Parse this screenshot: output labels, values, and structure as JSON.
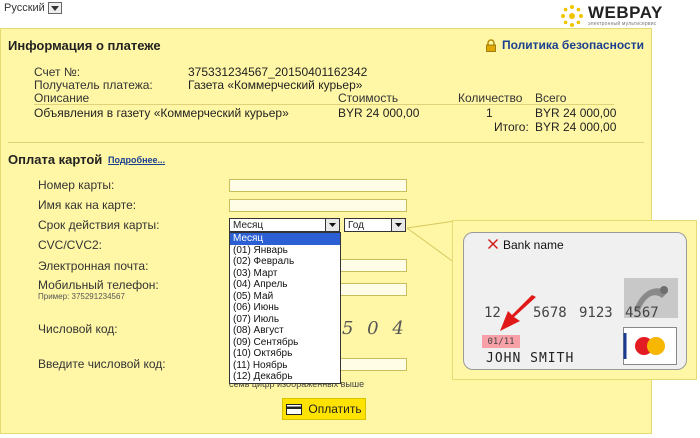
{
  "language": {
    "selected": "Русский"
  },
  "logo": {
    "brand": "WEBPAY",
    "tagline": "электронный мультисервис"
  },
  "payment_info": {
    "title": "Информация о платеже",
    "privacy_link": "Политика безопасности",
    "invoice_label": "Счет №:",
    "invoice_value": "375331234567_20150401162342",
    "recipient_label": "Получатель платежа:",
    "recipient_value": "Газета «Коммерческий курьер»",
    "table": {
      "headers": [
        "Описание",
        "Стоимость",
        "Количество",
        "Всего"
      ],
      "row": [
        "Объявления в газету «Коммерческий курьер»",
        "BYR 24 000,00",
        "1",
        "BYR 24 000,00"
      ],
      "total_label": "Итого:",
      "total_value": "BYR 24 000,00"
    }
  },
  "card_payment": {
    "title": "Оплата картой",
    "more_link": "Подробнее...",
    "card_number_label": "Номер карты:",
    "card_name_label": "Имя как на карте:",
    "expiry_label": "Срок действия карты:",
    "month_select": "Месяц",
    "year_select": "Год",
    "cvc_label": "CVC/CVC2:",
    "email_label": "Электронная почта:",
    "phone_label": "Мобильный телефон:",
    "phone_example": "Пример: 375291234567",
    "captcha_label": "Числовой код:",
    "captcha_input_label": "Введите числовой код:",
    "captcha_hint": "семь цифр изображенных выше",
    "captcha_fragment": "5 0 4",
    "pay_button": "Оплатить",
    "months": [
      "Месяц",
      "(01) Январь",
      "(02) Февраль",
      "(03) Март",
      "(04) Апрель",
      "(05) Май",
      "(06) Июнь",
      "(07) Июль",
      "(08) Август",
      "(09) Сентябрь",
      "(10) Октябрь",
      "(11) Ноябрь",
      "(12) Декабрь"
    ]
  },
  "card_illustration": {
    "bank_name": "Bank name",
    "number_start": "12",
    "number_groups": [
      "5678",
      "9123",
      "4567"
    ],
    "expiry": "01/11",
    "holder": "JOHN SMITH"
  },
  "colors": {
    "panel": "#fff7a6",
    "link": "#1b3f8f",
    "button": "#ffe300",
    "highlight": "#2b5fd3",
    "arrow": "#e01818"
  }
}
